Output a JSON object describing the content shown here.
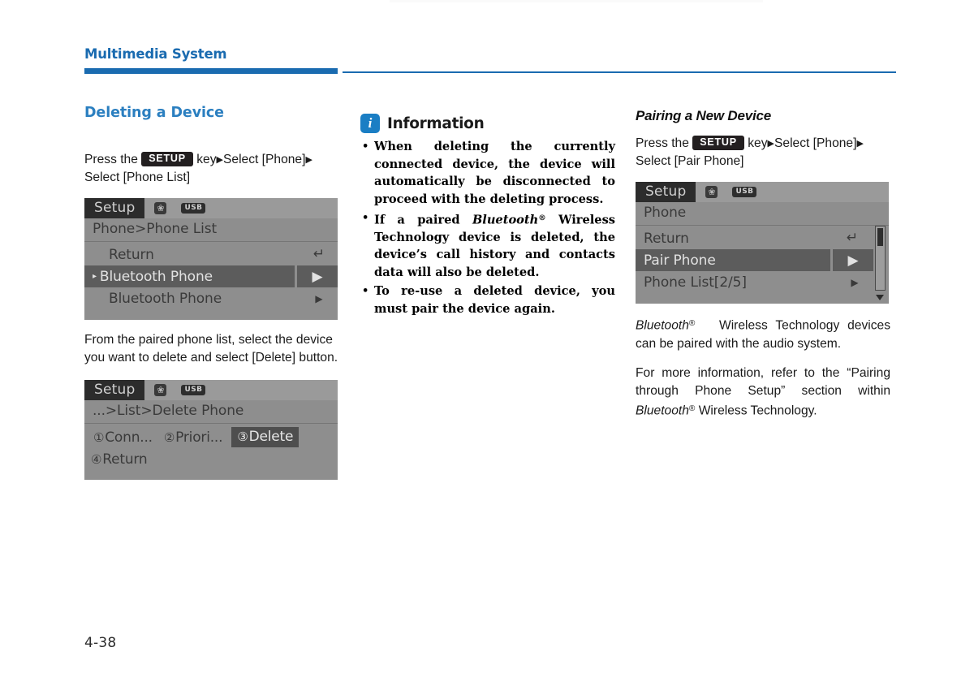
{
  "header": {
    "chapter_title": "Multimedia System"
  },
  "footer": {
    "page_number": "4-38"
  },
  "left_column": {
    "heading": "Deleting a Device",
    "intro": {
      "before_key": "Press    the",
      "key_label": "SETUP",
      "after_key": "key",
      "arrow": "▶",
      "select_1": "Select [Phone]",
      "select_2": "Select [Phone List]"
    },
    "screen_1": {
      "title": "Setup",
      "icons": [
        "bluetooth-icon",
        "usb-icon"
      ],
      "usb_label": "USB",
      "breadcrumb": "Phone>Phone List",
      "rows": [
        {
          "label": "Return",
          "right": "return-arrow",
          "state": "normal",
          "indent": true
        },
        {
          "label": "Bluetooth Phone",
          "right": "▶",
          "state": "selected",
          "caret": "▸"
        },
        {
          "label": "Bluetooth Phone",
          "right": "▶",
          "state": "normal",
          "indent": true
        }
      ]
    },
    "body_text": "From the paired phone list, select the device you want to delete and select [Delete] button.",
    "screen_2": {
      "title": "Setup",
      "usb_label": "USB",
      "breadcrumb": "...>List>Delete Phone",
      "buttons": [
        {
          "num": "①",
          "label": "Conn...",
          "active": false
        },
        {
          "num": "②",
          "label": "Priori...",
          "active": false
        },
        {
          "num": "③",
          "label": "Delete",
          "active": true
        }
      ],
      "return_row": {
        "num": "④",
        "label": "Return"
      }
    }
  },
  "middle_column": {
    "info_title": "Information",
    "info_icon": "i",
    "bullets": [
      {
        "parts": [
          {
            "text": "When deleting the currently connected device, the device will automatically be disconnected to proceed with the deleting process.",
            "style": "normal"
          }
        ]
      },
      {
        "parts": [
          {
            "text": "If a paired ",
            "style": "normal"
          },
          {
            "text": "Bluetooth",
            "style": "italic"
          },
          {
            "text": "®",
            "style": "reg"
          },
          {
            "text": " Wireless Technology device is deleted, the device’s call history and contacts data will also be deleted.",
            "style": "normal"
          }
        ]
      },
      {
        "parts": [
          {
            "text": "To re-use a deleted device, you must pair the device again.",
            "style": "normal"
          }
        ]
      }
    ]
  },
  "right_column": {
    "heading": "Pairing a New Device",
    "intro": {
      "before_key": "Press    the",
      "key_label": "SETUP",
      "after_key": "key",
      "arrow": "▶",
      "select_1": "Select [Phone]",
      "select_2": "Select [Pair Phone]"
    },
    "screen_3": {
      "title": "Setup",
      "usb_label": "USB",
      "breadcrumb": "Phone",
      "rows": [
        {
          "label": "Return",
          "right": "return-arrow",
          "state": "normal"
        },
        {
          "label": "Pair Phone",
          "right": "▶",
          "state": "selected"
        },
        {
          "label": "Phone List[2/5]",
          "right": "▶",
          "state": "normal"
        }
      ],
      "scrollbar": true
    },
    "paragraph_1": {
      "bt": "Bluetooth",
      "reg": "®",
      "rest": "Wireless Technology devices can be paired with the audio system."
    },
    "paragraph_2": {
      "lead": "For more information, refer to the “Pairing through Phone Setup” section within ",
      "bt": "Bluetooth",
      "reg": "®",
      "tail": " Wireless Technology."
    }
  },
  "colors": {
    "accent_blue": "#1a6bb0",
    "heading_blue": "#2b7fc0",
    "info_icon_blue": "#1a7ec4",
    "screen_bg": "#8e8e8e",
    "screen_titlebar": "#9a9a9a",
    "screen_dark": "#2c2c2c",
    "screen_selected": "#5c5c5c",
    "text_black": "#1a1a1a"
  }
}
